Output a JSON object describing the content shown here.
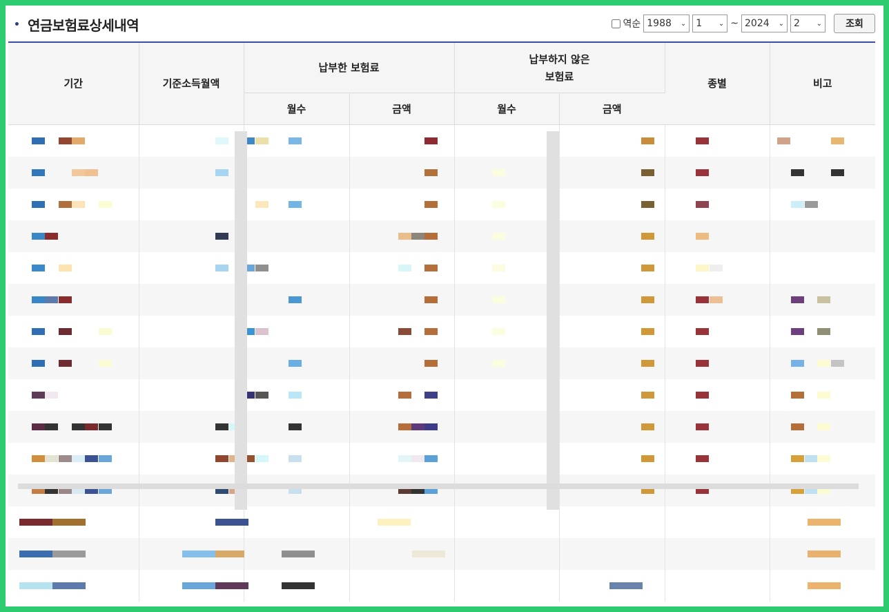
{
  "header": {
    "title": "연금보험료상세내역",
    "reverse_label": "역순",
    "from_year": "1988",
    "from_month": "1",
    "range_sep": "~",
    "to_year": "2024",
    "to_month": "2",
    "search_label": "조회"
  },
  "table": {
    "col_period": "기간",
    "col_base_income": "기준소득월액",
    "col_paid": "납부한 보험료",
    "col_unpaid_line1": "납부하지 않은",
    "col_unpaid_line2": "보험료",
    "col_type": "종별",
    "col_note": "비고",
    "sub_months": "월수",
    "sub_amount": "금액",
    "sub_months2": "월수",
    "sub_amount2": "금액"
  }
}
